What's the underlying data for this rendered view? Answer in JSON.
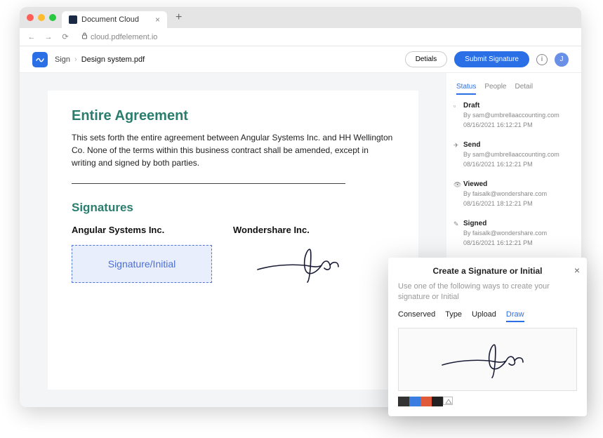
{
  "browser": {
    "tab_title": "Document Cloud",
    "url": "cloud.pdfelement.io"
  },
  "header": {
    "breadcrumb": [
      "Sign",
      "Design system.pdf"
    ],
    "details_btn": "Detials",
    "submit_btn": "Submit Signature",
    "avatar_letter": "J"
  },
  "document": {
    "section1_title": "Entire Agreement",
    "section1_body": "This sets forth the entire agreement between Angular Systems Inc. and HH Wellington Co. None of the terms within this business contract shall be amended, except in writing and signed by both parties.",
    "section2_title": "Signatures",
    "party1": "Angular Systems Inc.",
    "party2": "Wondershare Inc.",
    "placeholder": "Signature/Initial"
  },
  "sidebar": {
    "tabs": [
      "Status",
      "People",
      "Detail"
    ],
    "timeline": [
      {
        "icon": "draft",
        "title": "Draft",
        "by": "By sam@umbrellaaccounting.com",
        "time": "08/16/2021 16:12:21 PM"
      },
      {
        "icon": "send",
        "title": "Send",
        "by": "By sam@umbrellaaccounting.com",
        "time": "08/16/2021 16:12:21 PM"
      },
      {
        "icon": "viewed",
        "title": "Viewed",
        "by": "By faisalk@wondershare.com",
        "time": "08/16/2021 18:12:21 PM"
      },
      {
        "icon": "signed",
        "title": "Signed",
        "by": "By faisalk@wondershare.com",
        "time": "08/16/2021 16:12:21 PM"
      }
    ]
  },
  "modal": {
    "title": "Create a Signature or Initial",
    "subtitle": "Use one of the following ways to create your signature or Initial",
    "tabs": [
      "Conserved",
      "Type",
      "Upload",
      "Draw"
    ],
    "active_tab": "Draw",
    "colors": [
      "#333333",
      "#3a7de0",
      "#e05a3a",
      "#222222"
    ]
  }
}
